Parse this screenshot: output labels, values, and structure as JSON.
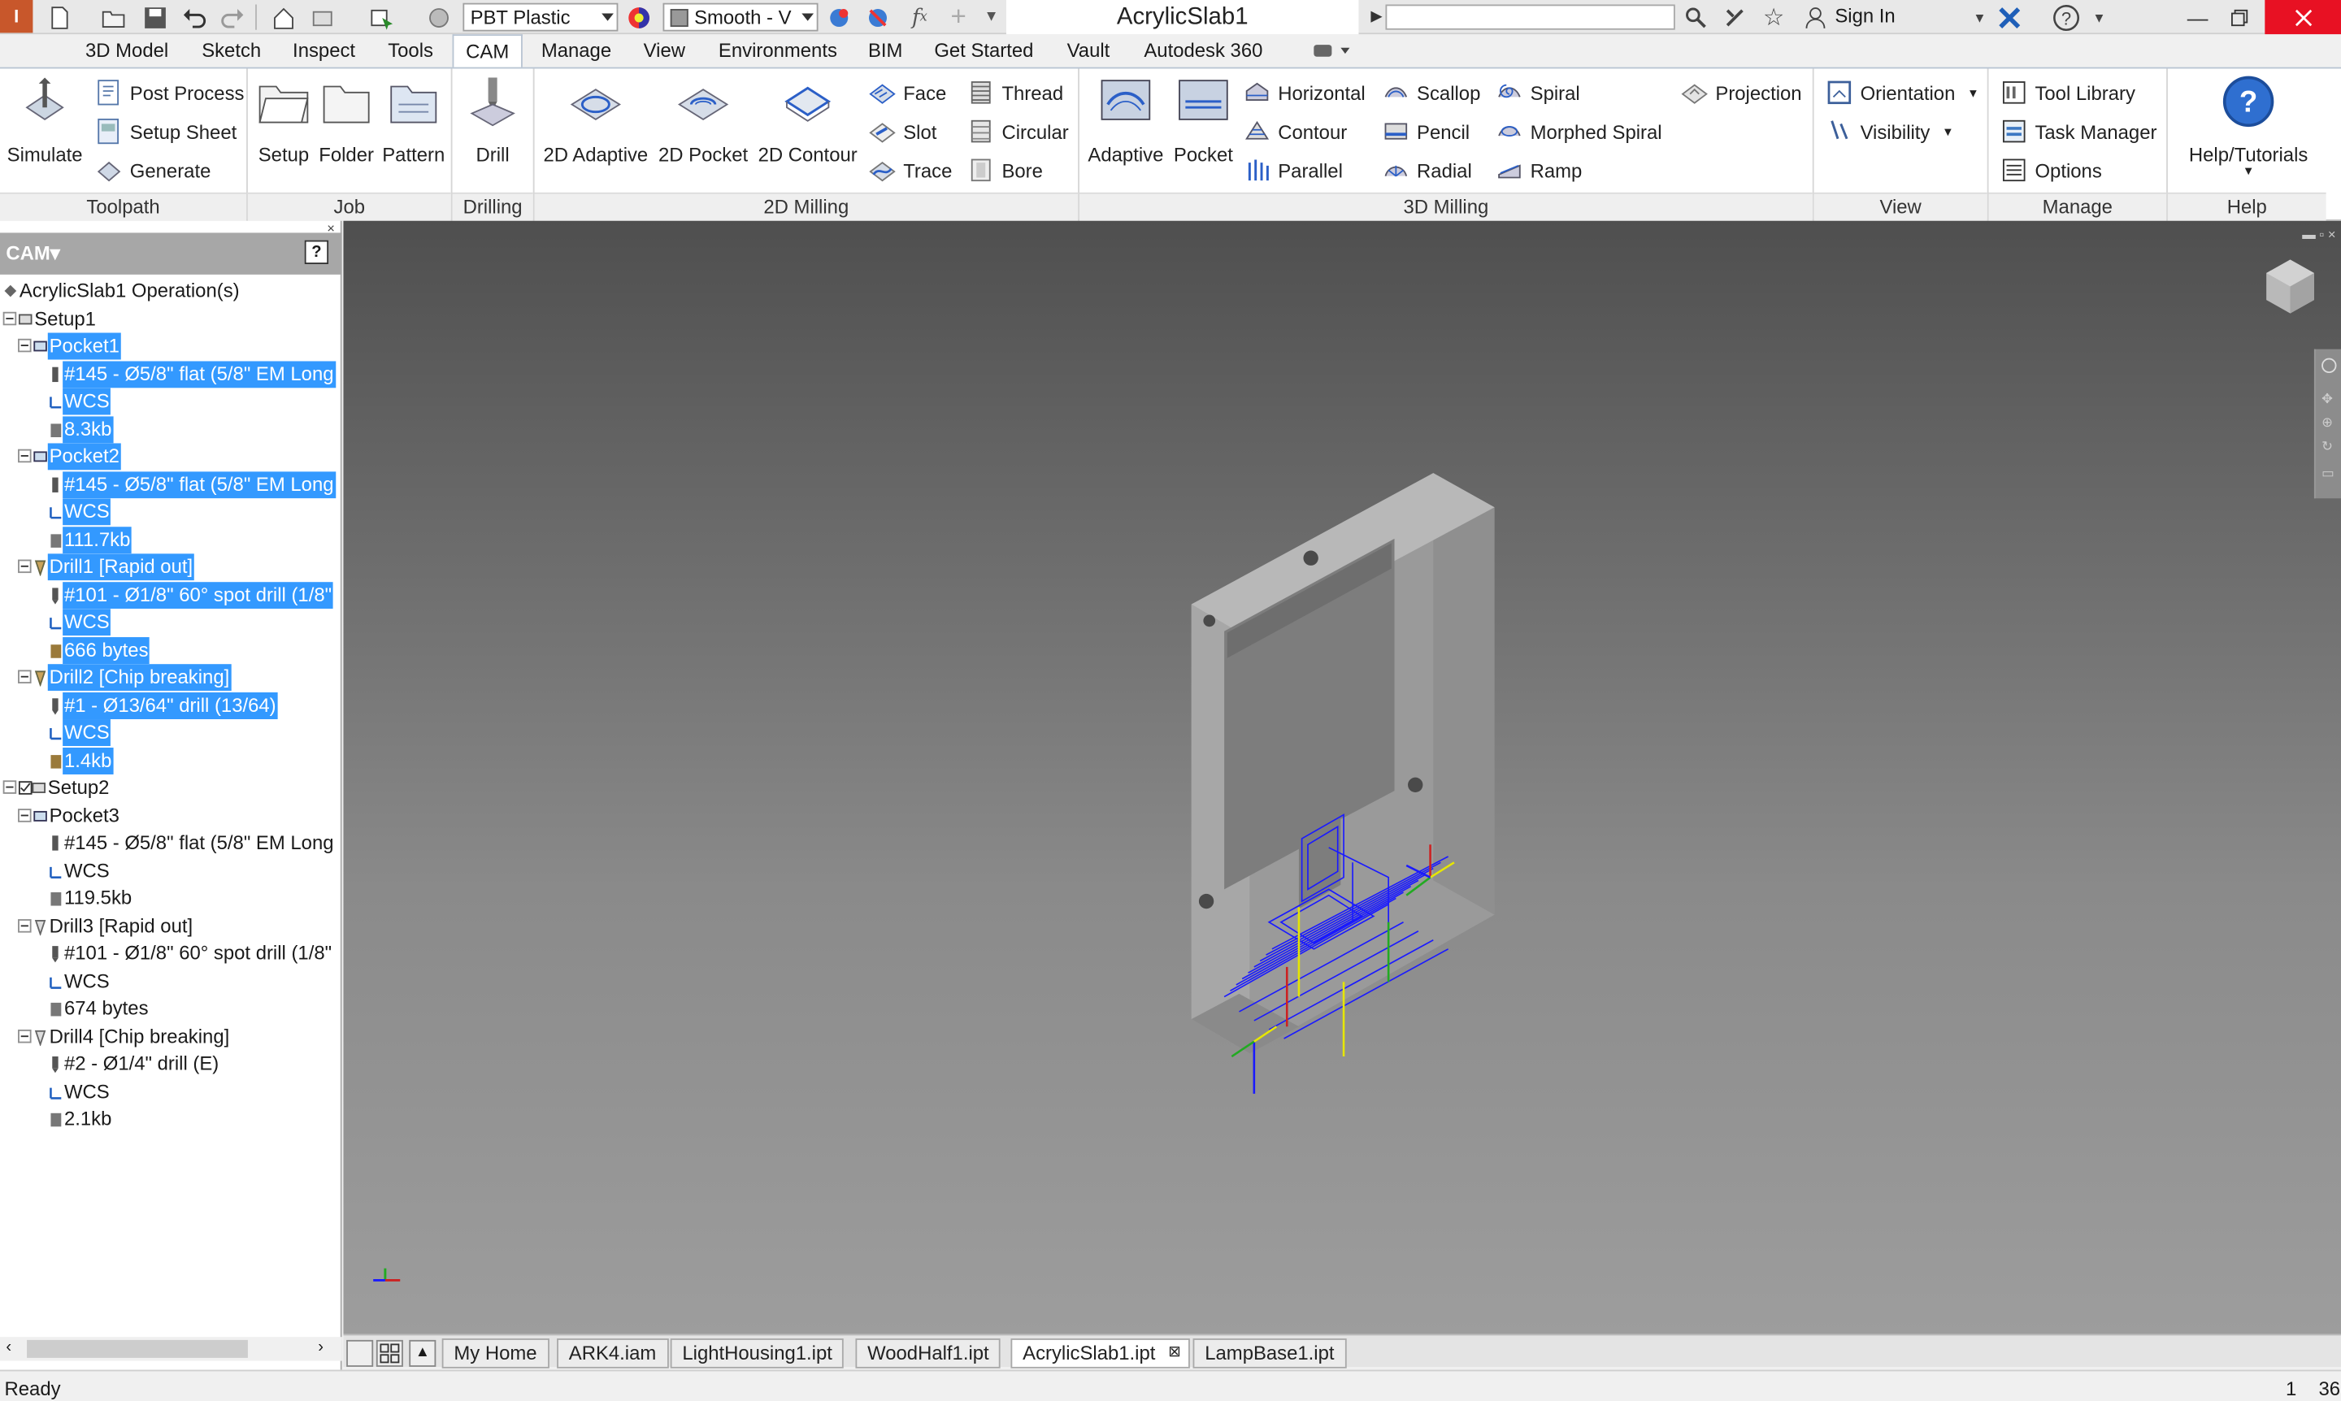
{
  "app": {
    "title": "AcrylicSlab1",
    "material": "PBT Plastic",
    "visual_style": "Smooth - V",
    "sign_in": "Sign In",
    "help_search_placeholder": ""
  },
  "tabs": [
    "3D Model",
    "Sketch",
    "Inspect",
    "Tools",
    "CAM",
    "Manage",
    "View",
    "Environments",
    "BIM",
    "Get Started",
    "Vault",
    "Autodesk 360"
  ],
  "active_tab": "CAM",
  "ribbon": {
    "toolpath": {
      "title": "Toolpath",
      "simulate": "Simulate",
      "post_process": "Post Process",
      "setup_sheet": "Setup Sheet",
      "generate": "Generate"
    },
    "job": {
      "title": "Job",
      "setup": "Setup",
      "folder": "Folder",
      "pattern": "Pattern"
    },
    "drilling": {
      "title": "Drilling",
      "drill": "Drill"
    },
    "milling2d": {
      "title": "2D Milling",
      "adaptive": "2D Adaptive",
      "pocket": "2D Pocket",
      "contour": "2D Contour",
      "face": "Face",
      "slot": "Slot",
      "trace": "Trace",
      "thread": "Thread",
      "circular": "Circular",
      "bore": "Bore"
    },
    "milling3d": {
      "title": "3D Milling",
      "adaptive": "Adaptive",
      "pocket": "Pocket",
      "horizontal": "Horizontal",
      "contour": "Contour",
      "parallel": "Parallel",
      "scallop": "Scallop",
      "pencil": "Pencil",
      "radial": "Radial",
      "spiral": "Spiral",
      "morphed_spiral": "Morphed Spiral",
      "ramp": "Ramp",
      "projection": "Projection"
    },
    "view": {
      "title": "View",
      "orientation": "Orientation",
      "visibility": "Visibility"
    },
    "manage": {
      "title": "Manage",
      "tool_library": "Tool Library",
      "task_manager": "Task Manager",
      "options": "Options"
    },
    "help": {
      "title": "Help",
      "help_tutorials": "Help/Tutorials"
    }
  },
  "browser": {
    "title": "CAM",
    "root": "AcrylicSlab1 Operation(s)",
    "setup1": "Setup1",
    "pocket1": {
      "name": "Pocket1",
      "tool": "#145 - Ø5/8\" flat (5/8\" EM Long",
      "wcs": "WCS",
      "size": "8.3kb"
    },
    "pocket2": {
      "name": "Pocket2",
      "tool": "#145 - Ø5/8\" flat (5/8\" EM Long",
      "wcs": "WCS",
      "size": "111.7kb"
    },
    "drill1": {
      "name": "Drill1 [Rapid out]",
      "tool": "#101 - Ø1/8\" 60° spot drill (1/8\"",
      "wcs": "WCS",
      "size": "666 bytes"
    },
    "drill2": {
      "name": "Drill2 [Chip breaking]",
      "tool": "#1 - Ø13/64\" drill (13/64)",
      "wcs": "WCS",
      "size": "1.4kb"
    },
    "setup2": "Setup2",
    "pocket3": {
      "name": "Pocket3",
      "tool": "#145 - Ø5/8\" flat (5/8\" EM Long",
      "wcs": "WCS",
      "size": "119.5kb"
    },
    "drill3": {
      "name": "Drill3 [Rapid out]",
      "tool": "#101 - Ø1/8\" 60° spot drill (1/8\"",
      "wcs": "WCS",
      "size": "674 bytes"
    },
    "drill4": {
      "name": "Drill4 [Chip breaking]",
      "tool": "#2 - Ø1/4\" drill (E)",
      "wcs": "WCS",
      "size": "2.1kb"
    }
  },
  "doc_tabs": [
    "My Home",
    "ARK4.iam",
    "LightHousing1.ipt",
    "WoodHalf1.ipt",
    "AcrylicSlab1.ipt",
    "LampBase1.ipt"
  ],
  "active_doc": "AcrylicSlab1.ipt",
  "status": {
    "text": "Ready",
    "n1": "1",
    "n2": "36"
  },
  "colors": {
    "selection": "#3399ff",
    "ribbon_accent": "#3c78c3",
    "toolpath": "#1a1aff",
    "viewport_top": "#4f4f4f",
    "viewport_bottom": "#9d9d9d"
  }
}
